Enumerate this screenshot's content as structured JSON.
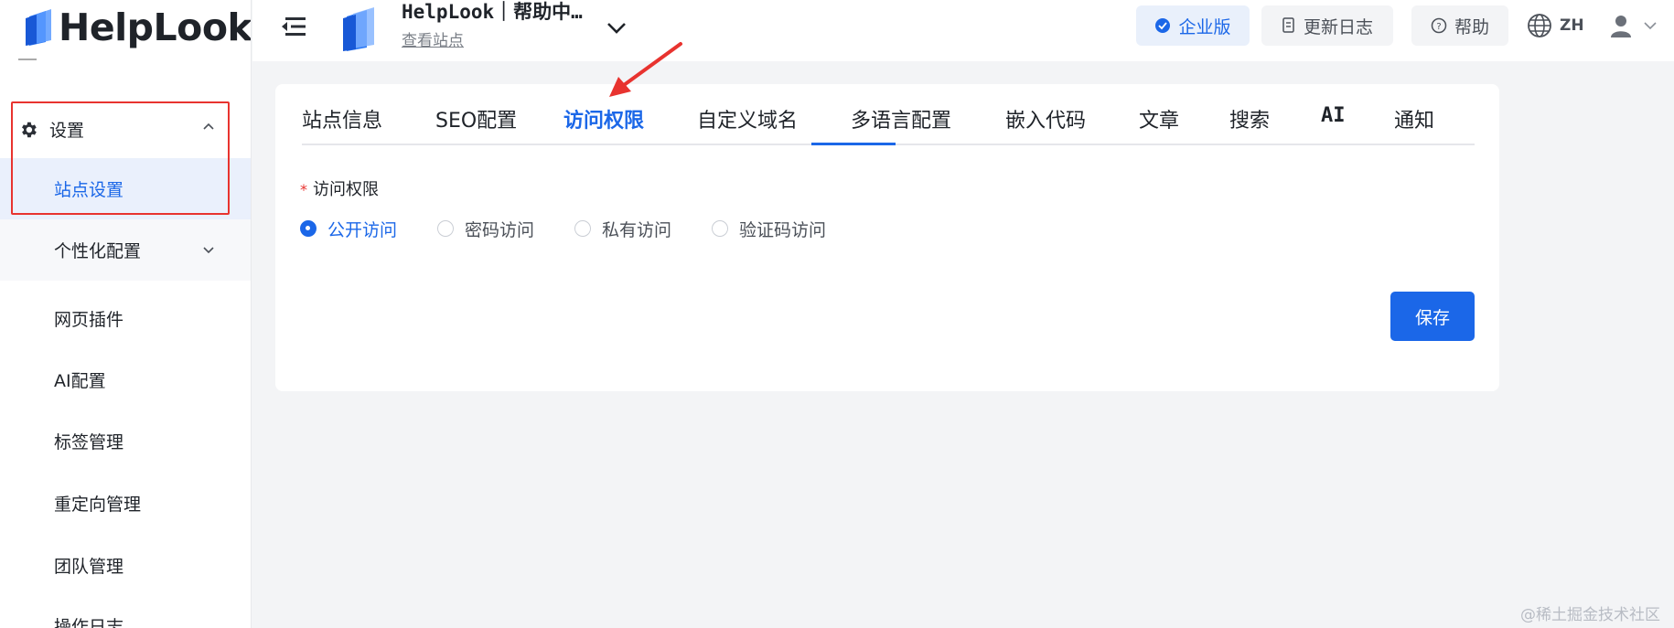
{
  "sidebar": {
    "logo_text": "HelpLook",
    "settings_label": "设置",
    "items": [
      {
        "label": "站点设置"
      },
      {
        "label": "个性化配置"
      },
      {
        "label": "网页插件"
      },
      {
        "label": "AI配置"
      },
      {
        "label": "标签管理"
      },
      {
        "label": "重定向管理"
      },
      {
        "label": "团队管理"
      },
      {
        "label": "操作日志"
      }
    ]
  },
  "header": {
    "site_title": "HelpLook｜帮助中…",
    "site_link": "查看站点",
    "enterprise": "企业版",
    "changelog": "更新日志",
    "help": "帮助",
    "lang": "ZH"
  },
  "tabs": [
    "站点信息",
    "SEO配置",
    "访问权限",
    "自定义域名",
    "多语言配置",
    "嵌入代码",
    "文章",
    "搜索",
    "AI",
    "通知"
  ],
  "active_tab": "访问权限",
  "form": {
    "label": "访问权限",
    "required_mark": "*",
    "options": [
      "公开访问",
      "密码访问",
      "私有访问",
      "验证码访问"
    ],
    "selected": "公开访问",
    "save": "保存"
  },
  "watermark": "@稀土掘金技术社区",
  "colors": {
    "accent": "#1b67e8",
    "annotation_red": "#e8332f",
    "background": "#f3f4f6"
  }
}
